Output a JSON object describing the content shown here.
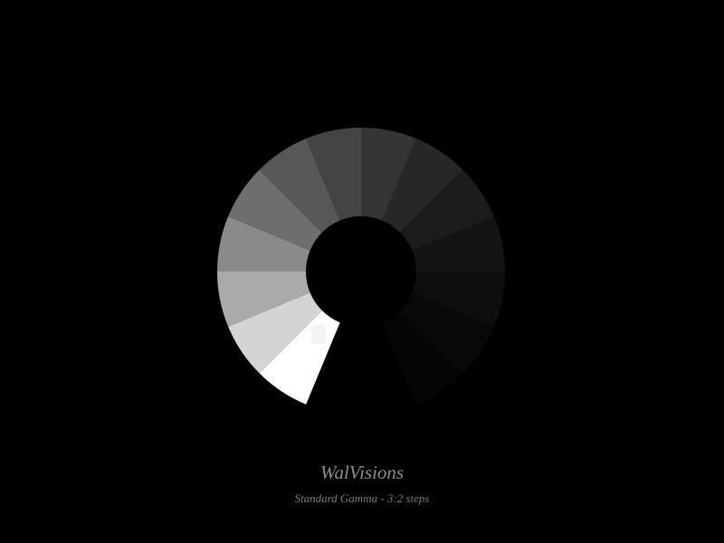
{
  "title": "WalVisions",
  "subtitle": "Standard Gamma - 3:2 steps",
  "wheel": {
    "segment_colors": [
      "#ffffff",
      "#d4d4d4",
      "#aaaaaa",
      "#8a8a8a",
      "#6e6e6e",
      "#575757",
      "#444444",
      "#343434",
      "#272727",
      "#1c1c1c",
      "#141414",
      "#0e0e0e",
      "#090909",
      "#050505"
    ],
    "patch_color": "#f4f4f4",
    "background": "#000000"
  }
}
